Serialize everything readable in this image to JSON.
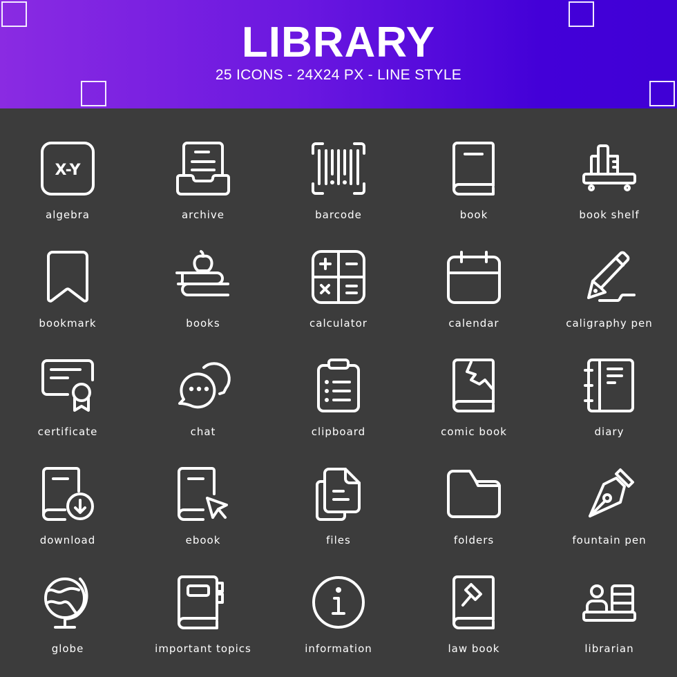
{
  "header": {
    "title": "LIBRARY",
    "subtitle": "25 ICONS - 24X24 PX - LINE STYLE",
    "gradient_start": "#8a2be2",
    "gradient_end": "#4000d6"
  },
  "theme": {
    "background": "#3c3c3c",
    "icon_color": "#ffffff",
    "label_color": "#ffffff"
  },
  "icons": [
    {
      "label": "algebra",
      "icon": "algebra-icon",
      "glyph_text": "X-Y"
    },
    {
      "label": "archive",
      "icon": "archive-icon"
    },
    {
      "label": "barcode",
      "icon": "barcode-icon"
    },
    {
      "label": "book",
      "icon": "book-icon"
    },
    {
      "label": "book shelf",
      "icon": "book-shelf-icon"
    },
    {
      "label": "bookmark",
      "icon": "bookmark-icon"
    },
    {
      "label": "books",
      "icon": "books-icon"
    },
    {
      "label": "calculator",
      "icon": "calculator-icon"
    },
    {
      "label": "calendar",
      "icon": "calendar-icon"
    },
    {
      "label": "caligraphy pen",
      "icon": "caligraphy-pen-icon"
    },
    {
      "label": "certificate",
      "icon": "certificate-icon"
    },
    {
      "label": "chat",
      "icon": "chat-icon"
    },
    {
      "label": "clipboard",
      "icon": "clipboard-icon"
    },
    {
      "label": "comic book",
      "icon": "comic-book-icon"
    },
    {
      "label": "diary",
      "icon": "diary-icon"
    },
    {
      "label": "download",
      "icon": "download-icon"
    },
    {
      "label": "ebook",
      "icon": "ebook-icon"
    },
    {
      "label": "files",
      "icon": "files-icon"
    },
    {
      "label": "folders",
      "icon": "folders-icon"
    },
    {
      "label": "fountain pen",
      "icon": "fountain-pen-icon"
    },
    {
      "label": "globe",
      "icon": "globe-icon"
    },
    {
      "label": "important topics",
      "icon": "important-topics-icon"
    },
    {
      "label": "information",
      "icon": "information-icon",
      "glyph_text": "i"
    },
    {
      "label": "law book",
      "icon": "law-book-icon"
    },
    {
      "label": "librarian",
      "icon": "librarian-icon"
    }
  ]
}
